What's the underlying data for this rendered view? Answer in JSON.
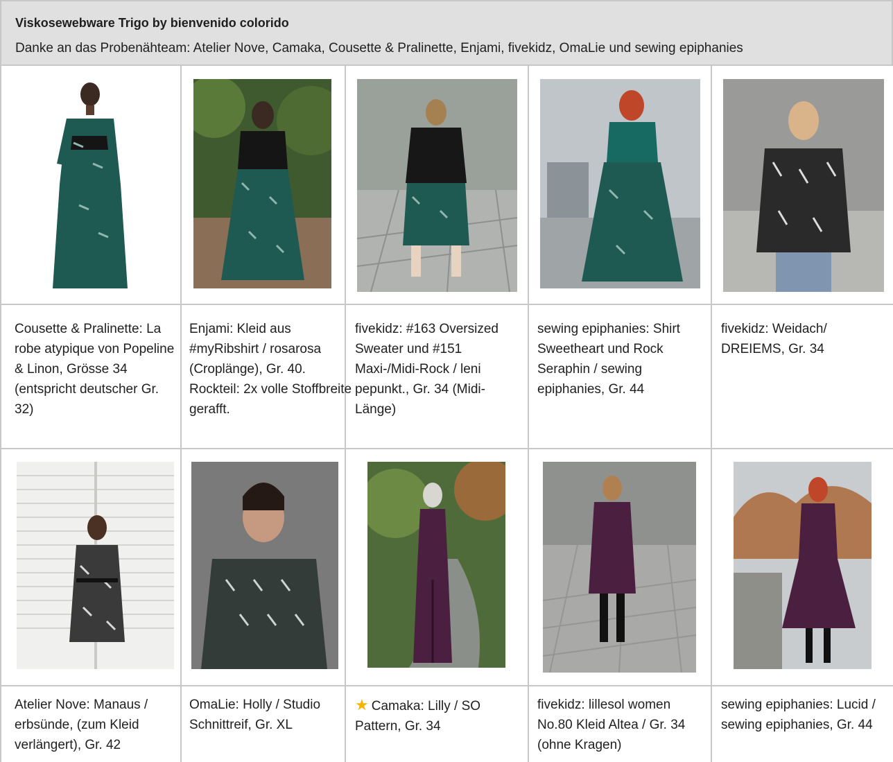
{
  "header": {
    "title": "Viskosewebware Trigo by bienvenido colorido",
    "subtitle": "Danke an das Probenähteam: Atelier Nove, Camaka, Cousette & Pralinette, Enjami, fivekidz, OmaLie und sewing epiphanies"
  },
  "row1": {
    "captions": [
      "Cousette & Pralinette: La robe atypique von Popeline & Linon, Grösse 34 (entspricht deutscher Gr. 32)",
      "Enjami: Kleid aus #myRibshirt / rosarosa (Croplänge), Gr. 40. Rockteil: 2x volle Stoffbreite gerafft.",
      "fivekidz: #163 Oversized Sweater und #151 Maxi-/Midi-Rock / leni pepunkt., Gr. 34 (Midi-Länge)",
      "sewing epiphanies: Shirt Sweetheart und Rock Seraphin / sewing epiphanies, Gr. 44",
      "fivekidz: Weidach/ DREIEMS, Gr. 34"
    ]
  },
  "row2": {
    "captions": [
      "Atelier Nove: Manaus / erbsünde, (zum Kleid verlängert), Gr. 42",
      "OmaLie: Holly / Studio Schnittreif, Gr. XL",
      "Camaka: Lilly / SO Pattern, Gr. 34",
      "fivekidz: lillesol women No.80 Kleid Altea / Gr. 34 (ohne Kragen)",
      "sewing epiphanies: Lucid / sewing epiphanies, Gr. 44"
    ],
    "star_icon": "star-icon"
  },
  "colors": {
    "header_bg": "#e0e0e0",
    "grid_line": "#c7c7c7",
    "fabric_teal": "#1f5a52",
    "fabric_plum": "#4a1f3f",
    "star": "#f5b400"
  }
}
